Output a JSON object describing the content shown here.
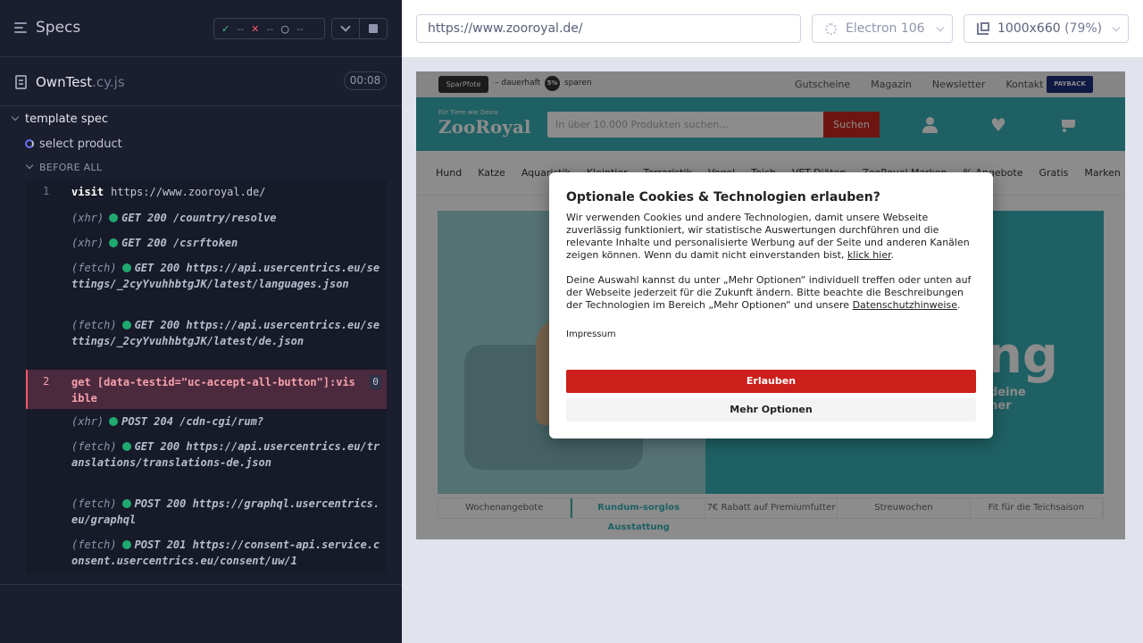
{
  "specs": {
    "title": "Specs",
    "passed": "--",
    "failed": "--",
    "pending": "--"
  },
  "file": {
    "name": "OwnTest",
    "ext": ".cy.js",
    "duration": "00:08"
  },
  "suite": {
    "name": "template spec",
    "test": "select product",
    "hook": "BEFORE ALL"
  },
  "commands": [
    {
      "num": "1",
      "kind": "visit",
      "label": "visit",
      "url": "https://www.zooroyal.de/"
    },
    {
      "kind": "(xhr)",
      "method": "GET 200",
      "path": "/country/resolve"
    },
    {
      "kind": "(xhr)",
      "method": "GET 200",
      "path": "/csrftoken"
    },
    {
      "kind": "(fetch)",
      "method": "GET 200",
      "path": "https://api.usercentrics.eu/settings/_2cyYvuhhbtgJK/latest/languages.json"
    },
    {
      "kind": "(fetch)",
      "method": "GET 200",
      "path": "https://api.usercentrics.eu/settings/_2cyYvuhhbtgJK/latest/de.json"
    },
    {
      "num": "2",
      "kind": "get",
      "label": "get",
      "selector": "[data-testid=\"uc-accept-all-button\"]:visible",
      "count": "0"
    },
    {
      "kind": "(xhr)",
      "method": "POST 204",
      "path": "/cdn-cgi/rum?"
    },
    {
      "kind": "(fetch)",
      "method": "GET 200",
      "path": "https://api.usercentrics.eu/translations/translations-de.json"
    },
    {
      "kind": "(fetch)",
      "method": "POST 200",
      "path": "https://graphql.usercentrics.eu/graphql"
    },
    {
      "kind": "(fetch)",
      "method": "POST 201",
      "path": "https://consent-api.service.consent.usercentrics.eu/consent/uw/1"
    }
  ],
  "toolbar": {
    "url": "https://www.zooroyal.de/",
    "browser": "Electron 106",
    "viewport": "1000x660",
    "zoom": "(79%)"
  },
  "site": {
    "spar_logo": "SparPfote",
    "spar_text": "– dauerhaft",
    "spar_pct": "5%",
    "spar_save": "sparen",
    "toplinks": [
      "Gutscheine",
      "Magazin",
      "Newsletter",
      "Kontakt"
    ],
    "payback": "PAYBACK",
    "logo_sub": "Für Tiere wie Deins",
    "logo": "ZooRoyal",
    "search_placeholder": "In über 10.000 Produkten suchen...",
    "search_button": "Suchen",
    "nav": [
      "Hund",
      "Katze",
      "Aquaristik",
      "Kleintier",
      "Terraristik",
      "Vogel",
      "Teich",
      "VET-Diäten",
      "ZooRoyal Marken",
      "% Angebote",
      "Gratis",
      "Marken"
    ],
    "hero_big": "ng",
    "hero_small_1": "deine",
    "hero_small_2": "ner",
    "tabs": [
      "Wochenangebote",
      "Rundum-sorglos Ausstattung",
      "7€ Rabatt auf Premiumfutter",
      "Streuwochen",
      "Fit für die Teichsaison"
    ]
  },
  "consent": {
    "title": "Optionale Cookies & Technologien erlauben?",
    "p1": "Wir verwenden Cookies und andere Technologien, damit unsere Webseite zuverlässig funktioniert, wir statistische Auswertungen durchführen und die relevante Inhalte und personalisierte Werbung auf der Seite und anderen Kanälen zeigen können. Wenn du damit nicht einverstanden bist,",
    "p1_link": "klick hier",
    "p2": "Deine Auswahl kannst du unter „Mehr Optionen“ individuell treffen oder unten auf der Webseite jederzeit für die Zukunft ändern. Bitte beachte die Beschreibungen der Technologien im Bereich „Mehr Optionen“ und unsere",
    "p2_link": "Datenschutzhinweise",
    "impressum": "Impressum",
    "allow": "Erlauben",
    "more": "Mehr Optionen"
  }
}
